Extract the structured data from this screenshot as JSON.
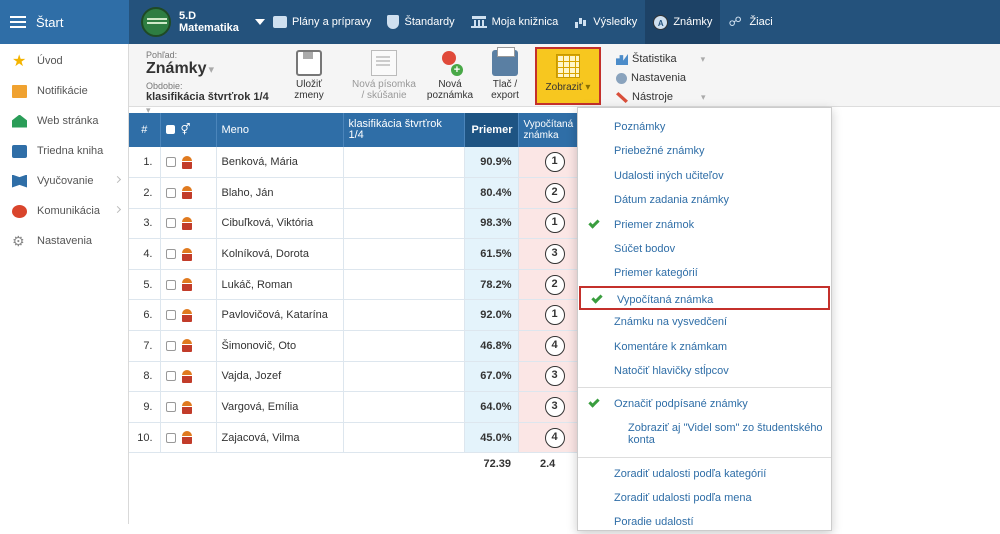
{
  "topnav": {
    "start_label": "Štart",
    "class_code": "5.D",
    "class_subject": "Matematika",
    "items": [
      {
        "label": "Plány a prípravy",
        "icon": "plans-icon"
      },
      {
        "label": "Štandardy",
        "icon": "shield-icon"
      },
      {
        "label": "Moja knižnica",
        "icon": "library-icon"
      },
      {
        "label": "Výsledky",
        "icon": "bar-chart-icon"
      },
      {
        "label": "Známky",
        "icon": "grade-icon",
        "active": true
      },
      {
        "label": "Žiaci",
        "icon": "pupils-icon"
      }
    ]
  },
  "sidebar": {
    "items": [
      {
        "label": "Úvod",
        "icon": "star-icon"
      },
      {
        "label": "Notifikácie",
        "icon": "mail-icon"
      },
      {
        "label": "Web stránka",
        "icon": "home-icon"
      },
      {
        "label": "Triedna kniha",
        "icon": "book-icon"
      },
      {
        "label": "Vyučovanie",
        "icon": "teaching-icon",
        "has_arrow": true
      },
      {
        "label": "Komunikácia",
        "icon": "chat-icon",
        "has_arrow": true
      },
      {
        "label": "Nastavenia",
        "icon": "gear-icon"
      }
    ]
  },
  "toolbar": {
    "view_label": "Pohľad:",
    "view_value": "Známky",
    "period_label": "Obdobie:",
    "period_value": "klasifikácia štvrťrok 1/4",
    "save_label_1": "Uložiť",
    "save_label_2": "zmeny",
    "new_test_label_1": "Nová písomka",
    "new_test_label_2": "/ skúšanie",
    "new_note_label_1": "Nová",
    "new_note_label_2": "poznámka",
    "print_label_1": "Tlač /",
    "print_label_2": "export",
    "show_label": "Zobraziť",
    "statistics_label": "Štatistika",
    "settings_label": "Nastavenia",
    "tools_label": "Nástroje"
  },
  "table": {
    "headers": {
      "num": "#",
      "name": "Meno",
      "column": "klasifikácia štvrťrok 1/4",
      "average": "Priemer",
      "calculated": "Vypočítaná známka"
    },
    "rows": [
      {
        "num": "1.",
        "name": "Benková, Mária",
        "avg": "90.9%",
        "grade": "1"
      },
      {
        "num": "2.",
        "name": "Blaho, Ján",
        "avg": "80.4%",
        "grade": "2"
      },
      {
        "num": "3.",
        "name": "Cibuľková, Viktória",
        "avg": "98.3%",
        "grade": "1"
      },
      {
        "num": "4.",
        "name": "Kolníková, Dorota",
        "avg": "61.5%",
        "grade": "3"
      },
      {
        "num": "5.",
        "name": "Lukáč, Roman",
        "avg": "78.2%",
        "grade": "2"
      },
      {
        "num": "6.",
        "name": "Pavlovičová, Katarína",
        "avg": "92.0%",
        "grade": "1"
      },
      {
        "num": "7.",
        "name": "Šimonovič, Oto",
        "avg": "46.8%",
        "grade": "4"
      },
      {
        "num": "8.",
        "name": "Vajda, Jozef",
        "avg": "67.0%",
        "grade": "3"
      },
      {
        "num": "9.",
        "name": "Vargová, Emília",
        "avg": "64.0%",
        "grade": "3"
      },
      {
        "num": "10.",
        "name": "Zajacová, Vilma",
        "avg": "45.0%",
        "grade": "4"
      }
    ],
    "footer_avg": "72.39",
    "footer_calc": "2.4"
  },
  "menu": {
    "items": [
      {
        "label": "Poznámky",
        "checked": false
      },
      {
        "label": "Priebežné známky",
        "checked": false
      },
      {
        "label": "Udalosti iných učiteľov",
        "checked": false
      },
      {
        "label": "Dátum zadania známky",
        "checked": false
      },
      {
        "label": "Priemer známok",
        "checked": true
      },
      {
        "label": "Súčet bodov",
        "checked": false
      },
      {
        "label": "Priemer kategórií",
        "checked": false
      },
      {
        "label": "Vypočítaná známka",
        "checked": true,
        "highlighted": true
      },
      {
        "label": "Známku na vysvedčení",
        "checked": false
      },
      {
        "label": "Komentáre k známkam",
        "checked": false
      },
      {
        "label": "Natočiť hlavičky stĺpcov",
        "checked": false
      }
    ],
    "group2": [
      {
        "label": "Označiť podpísané známky",
        "checked": true
      },
      {
        "label": "Zobraziť aj \"Videl som\" zo študentského konta",
        "checked": false,
        "sub": true
      }
    ],
    "group3": [
      {
        "label": "Zoradiť udalosti podľa kategórií"
      },
      {
        "label": "Zoradiť udalosti podľa mena"
      },
      {
        "label": "Poradie udalostí"
      }
    ]
  },
  "colors": {
    "topnav": "#24527c",
    "table_header": "#2f6ea7",
    "average_bg": "#e4f3fb",
    "calc_bg": "#fbe6e5",
    "show_button": "#f7c71f",
    "highlight_border": "#c4302b",
    "check_green": "#3a9e3f"
  }
}
